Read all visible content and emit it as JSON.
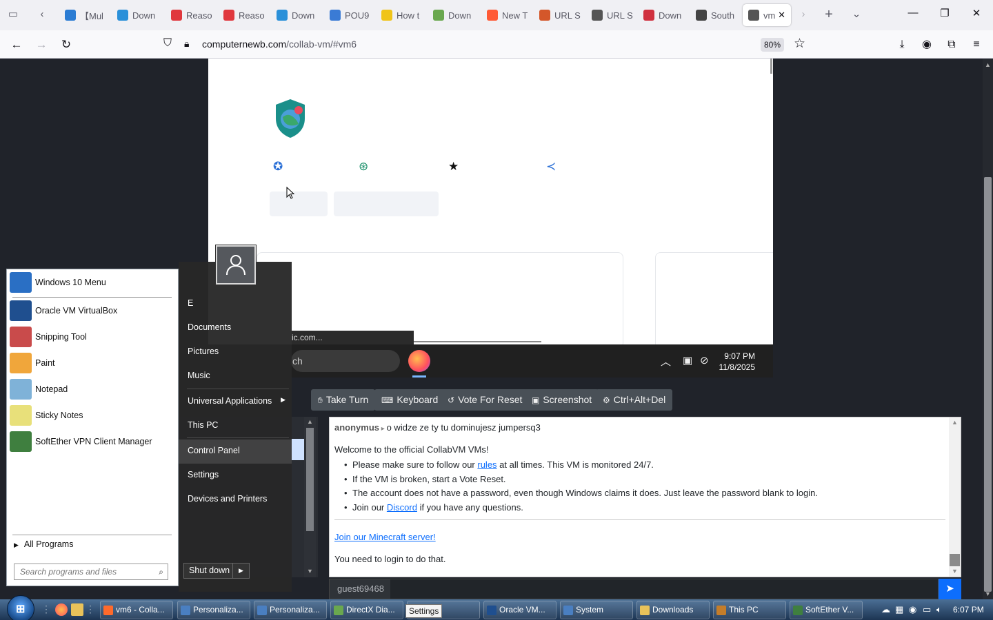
{
  "browser": {
    "tabs": [
      {
        "label": "【Mul",
        "icon": "word-icon",
        "color": "#2b7cd3"
      },
      {
        "label": "Down",
        "icon": "download-icon",
        "color": "#2a90d9"
      },
      {
        "label": "Reaso",
        "icon": "check-icon",
        "color": "#e0383e"
      },
      {
        "label": "Reaso",
        "icon": "check-icon",
        "color": "#e0383e"
      },
      {
        "label": "Down",
        "icon": "download-icon",
        "color": "#2a90d9"
      },
      {
        "label": "POU9",
        "icon": "pou-icon",
        "color": "#3a7bd5"
      },
      {
        "label": "How t",
        "icon": "question-icon",
        "color": "#f0c419"
      },
      {
        "label": "Down",
        "icon": "stack-icon",
        "color": "#6aa84f"
      },
      {
        "label": "New T",
        "icon": "firefox-icon",
        "color": "#ff5a36"
      },
      {
        "label": "URL S",
        "icon": "url-icon",
        "color": "#d4572a"
      },
      {
        "label": "URL S",
        "icon": "link-icon",
        "color": "#555555"
      },
      {
        "label": "Down",
        "icon": "m-icon",
        "color": "#d0313f"
      },
      {
        "label": "South",
        "icon": "south-icon",
        "color": "#444444"
      },
      {
        "label": "vm",
        "icon": "collabvm-icon",
        "color": "#555555"
      }
    ],
    "url_domain": "computernewb.com",
    "url_path": "/collab-vm/#vm6",
    "zoom": "80%"
  },
  "vm_screen": {
    "tooltip": "ic.com...",
    "search": "ch",
    "clock_time": "9:07 PM",
    "clock_date": "11/8/2025"
  },
  "controls": {
    "take_turn": "Take Turn",
    "keyboard": "Keyboard",
    "vote_reset": "Vote For Reset",
    "screenshot": "Screenshot",
    "ctrl_alt_del": "Ctrl+Alt+Del"
  },
  "chat": {
    "first_user": "anonymus",
    "first_message": "o widze ze ty tu dominujesz jumpersq3",
    "welcome": "Welcome to the official CollabVM VMs!",
    "rule1_pre": "Please make sure to follow our ",
    "rule1_link": "rules",
    "rule1_post": " at all times. This VM is monitored 24/7.",
    "rule2": "If the VM is broken, start a Vote Reset.",
    "rule3": "The account does not have a password, even though Windows claims it does. Just leave the password blank to login.",
    "rule4_pre": "Join our ",
    "rule4_link": "Discord",
    "rule4_post": " if you have any questions.",
    "minecraft_link": "Join our Minecraft server!",
    "login_msg": "You need to login to do that.",
    "username": "guest69468"
  },
  "start_menu": {
    "programs": [
      {
        "label": "Windows 10 Menu",
        "icon": "windows10-menu-icon",
        "color": "#2a6fc4"
      },
      {
        "label": "Oracle VM VirtualBox",
        "icon": "virtualbox-icon",
        "color": "#1f4f8f"
      },
      {
        "label": "Snipping Tool",
        "icon": "scissors-icon",
        "color": "#c94b4b"
      },
      {
        "label": "Paint",
        "icon": "paint-icon",
        "color": "#f0a63b"
      },
      {
        "label": "Notepad",
        "icon": "notepad-icon",
        "color": "#7fb2d8"
      },
      {
        "label": "Sticky Notes",
        "icon": "sticky-notes-icon",
        "color": "#e8e07a"
      },
      {
        "label": "SoftEther VPN Client Manager",
        "icon": "softether-icon",
        "color": "#3f7f3f"
      }
    ],
    "all_programs": "All Programs",
    "search_placeholder": "Search programs and files",
    "right_items": {
      "user": "E",
      "documents": "Documents",
      "pictures": "Pictures",
      "music": "Music",
      "universal_apps": "Universal Applications",
      "this_pc": "This PC",
      "control_panel": "Control Panel",
      "settings": "Settings",
      "devices": "Devices and Printers"
    },
    "shut_down": "Shut down"
  },
  "taskbar": {
    "buttons": [
      {
        "label": "vm6 - Colla...",
        "icon": "firefox-icon",
        "color": "#ff6a2b"
      },
      {
        "label": "Personaliza...",
        "icon": "personalize-icon",
        "color": "#4a7fc1"
      },
      {
        "label": "Personaliza...",
        "icon": "personalize-icon",
        "color": "#4a7fc1"
      },
      {
        "label": "DirectX Dia...",
        "icon": "directx-icon",
        "color": "#6aa84f"
      },
      {
        "label": "ngs",
        "icon": "settings-icon",
        "color": "#5a88c0"
      },
      {
        "label": "Oracle VM...",
        "icon": "virtualbox-icon",
        "color": "#1f4f8f"
      },
      {
        "label": "System",
        "icon": "system-icon",
        "color": "#4a7fc1"
      },
      {
        "label": "Downloads",
        "icon": "folder-icon",
        "color": "#e8c25a"
      },
      {
        "label": "This PC",
        "icon": "computer-icon",
        "color": "#c47d2a"
      },
      {
        "label": "SoftEther V...",
        "icon": "softether-icon",
        "color": "#3f7f3f"
      }
    ],
    "tooltip": "Settings",
    "clock": "6:07 PM"
  }
}
